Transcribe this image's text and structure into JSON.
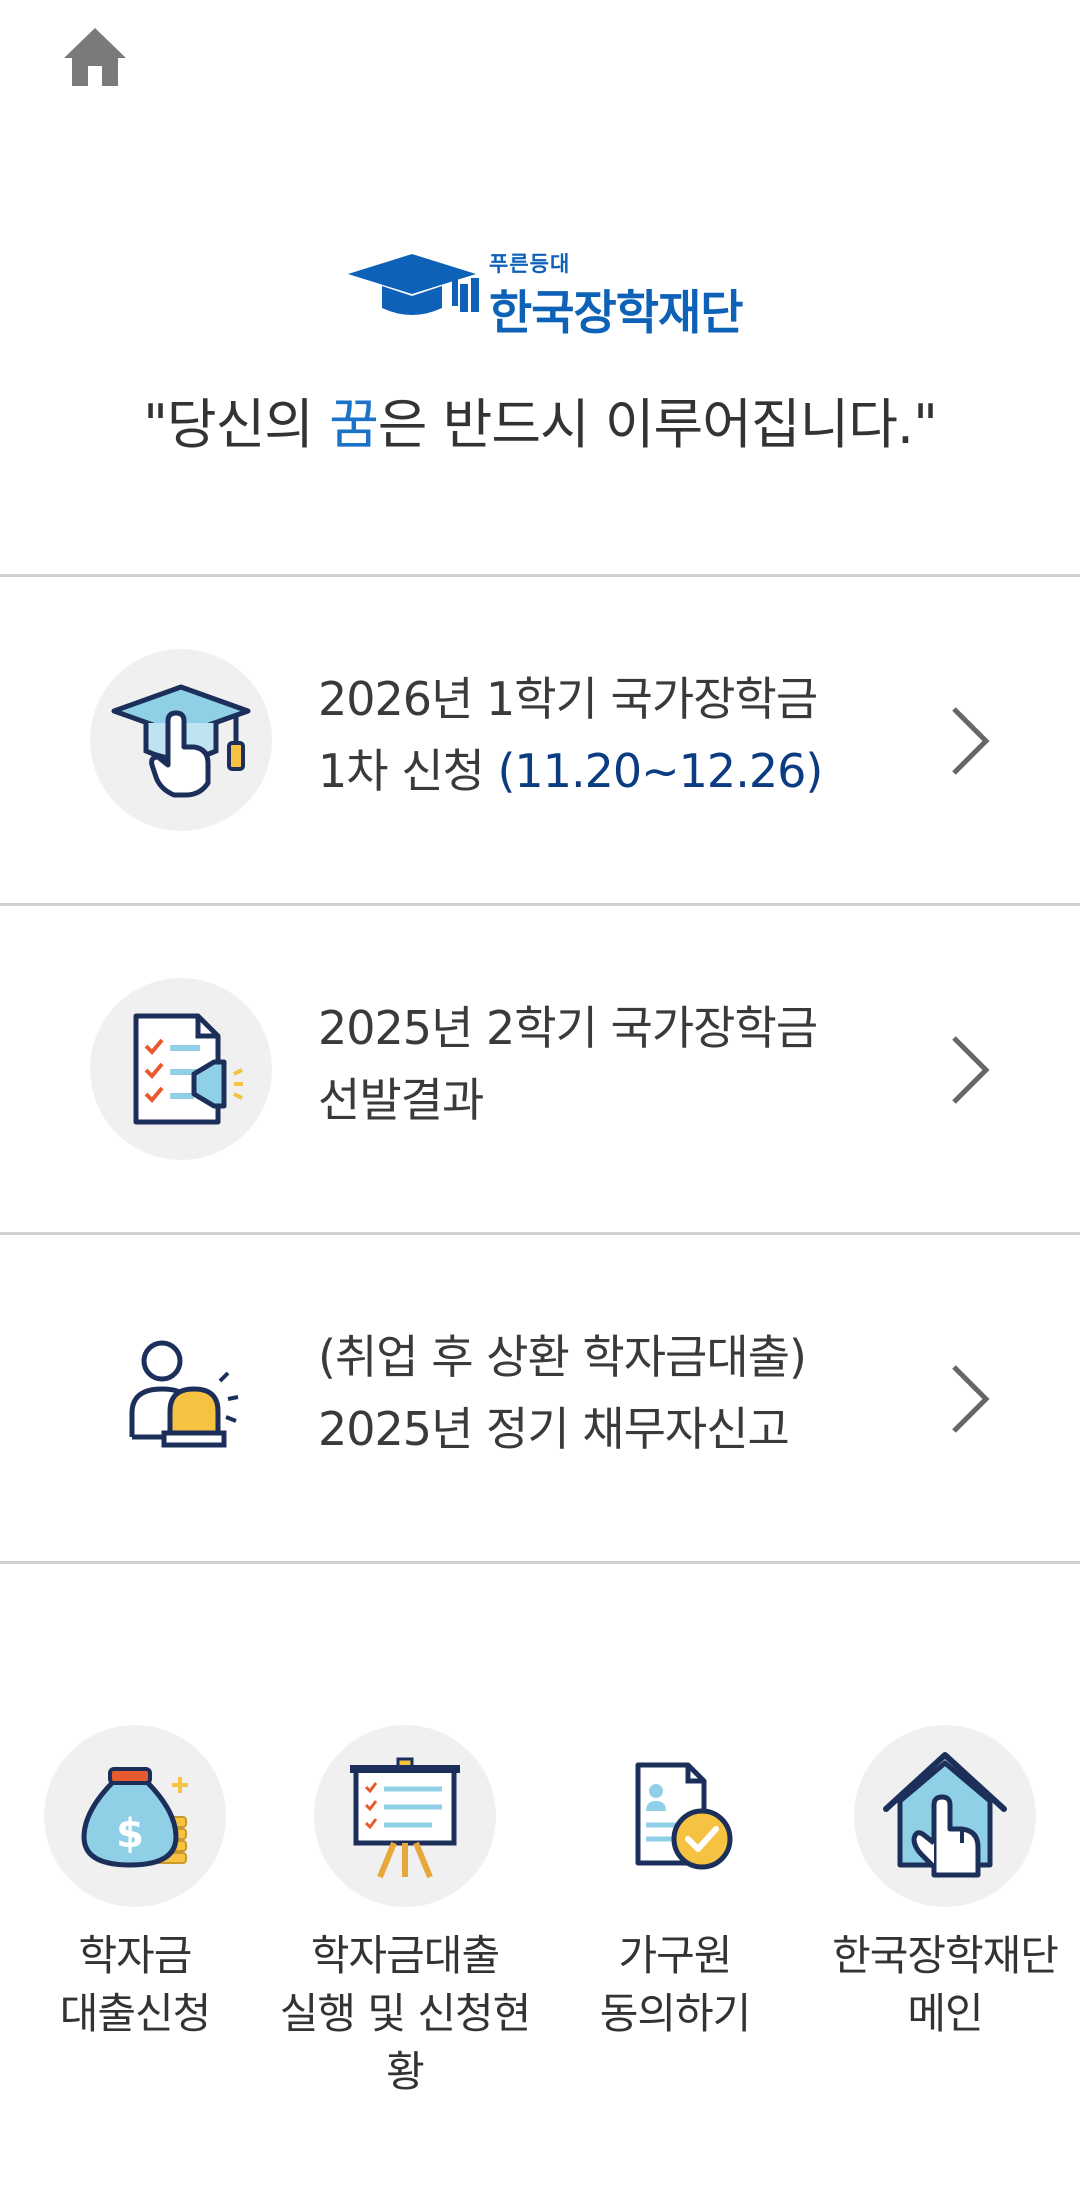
{
  "header": {
    "home_icon": "home-icon"
  },
  "logo": {
    "sub": "푸른등대",
    "main": "한국장학재단",
    "icon": "graduation-cap-logo"
  },
  "slogan": {
    "open": "\"당신의 ",
    "highlight": "꿈",
    "rest": "은 반드시 이루어집니다.\""
  },
  "menu": [
    {
      "icon": "graduation-cap-hand-icon",
      "line1": "2026년 1학기 국가장학금",
      "line2_prefix": "1차 신청 ",
      "line2_period": "(11.20~12.26)"
    },
    {
      "icon": "document-megaphone-icon",
      "line1": "2025년 2학기 국가장학금",
      "line2": "선발결과"
    },
    {
      "icon": "person-alarm-icon",
      "line1": "(취업 후 상환 학자금대출)",
      "line2": "2025년 정기 채무자신고"
    }
  ],
  "quick_links": [
    {
      "icon": "money-bag-icon",
      "line1": "학자금",
      "line2": "대출신청"
    },
    {
      "icon": "presentation-board-icon",
      "line1": "학자금대출",
      "line2": "실행 및 신청현",
      "line3": "황"
    },
    {
      "icon": "document-check-icon",
      "line1": "가구원",
      "line2": "동의하기"
    },
    {
      "icon": "house-hand-icon",
      "line1": "한국장학재단",
      "line2": "메인"
    }
  ],
  "colors": {
    "brand_blue": "#0d62b8",
    "highlight_blue": "#1a73c8",
    "period_blue": "#0b3c82",
    "divider": "#cfcfcf",
    "icon_circle": "#f0f0f0"
  }
}
